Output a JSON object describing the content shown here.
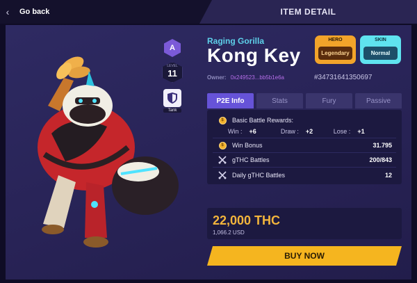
{
  "header": {
    "back_label": "Go back",
    "title": "ITEM DETAIL"
  },
  "badges": {
    "rank": "A",
    "level_caption": "LEVEL",
    "level": "11",
    "class_label": "Tank",
    "class_icon": "shield-icon"
  },
  "item": {
    "series": "Raging Gorilla",
    "name": "Kong Key",
    "owner_label": "Owner:",
    "owner_address": "0x249523...bb5b1e6a",
    "token_id": "#34731641350697"
  },
  "tags": {
    "hero_label": "HERO",
    "hero_value": "Legendary",
    "skin_label": "SKIN",
    "skin_value": "Normal"
  },
  "tabs": [
    {
      "label": "P2E Info",
      "active": true
    },
    {
      "label": "Stats",
      "active": false
    },
    {
      "label": "Fury",
      "active": false
    },
    {
      "label": "Passive",
      "active": false
    }
  ],
  "p2e": {
    "basic_rewards_label": "Basic Battle Rewards:",
    "win_label": "Win :",
    "win_value": "+6",
    "draw_label": "Draw :",
    "draw_value": "+2",
    "lose_label": "Lose :",
    "lose_value": "+1",
    "win_bonus_label": "Win Bonus",
    "win_bonus_value": "31.795",
    "gthc_label": "gTHC Battles",
    "gthc_value": "200/843",
    "daily_gthc_label": "Daily gTHC Battles",
    "daily_gthc_value": "12"
  },
  "price": {
    "amount": "22,000 THC",
    "usd": "1,066.2 USD"
  },
  "buy_label": "BUY NOW",
  "colors": {
    "accent": "#6653d8",
    "price": "#f3b53c",
    "buy_button": "#f5b51f",
    "series": "#5ed1ea"
  }
}
